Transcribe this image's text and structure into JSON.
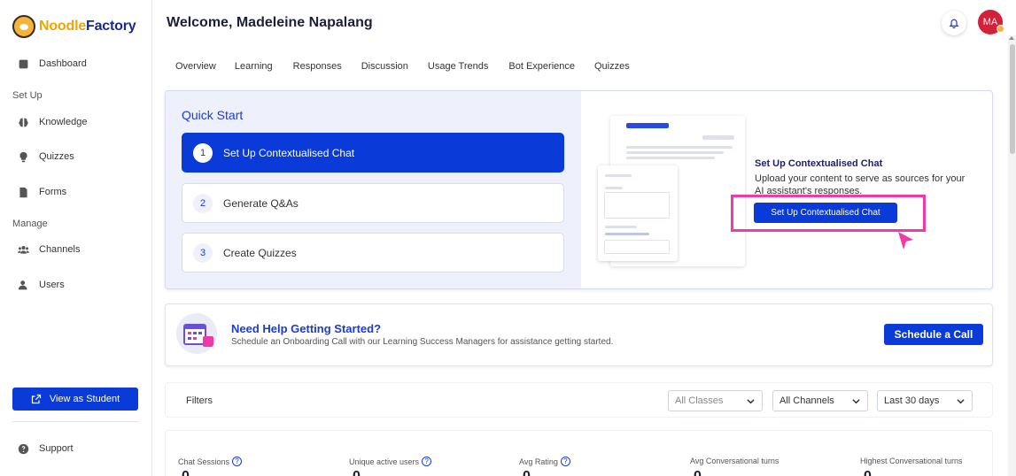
{
  "brand": {
    "name_part1": "Noodle",
    "name_part2": "Factory"
  },
  "sidebar": {
    "dashboard": "Dashboard",
    "setup_label": "Set Up",
    "knowledge": "Knowledge",
    "quizzes": "Quizzes",
    "forms": "Forms",
    "manage_label": "Manage",
    "channels": "Channels",
    "users": "Users",
    "view_student": "View as Student",
    "support": "Support"
  },
  "header": {
    "title": "Welcome, Madeleine Napalang",
    "avatar_initials": "MA"
  },
  "tabs": [
    "Overview",
    "Learning",
    "Responses",
    "Discussion",
    "Usage Trends",
    "Bot Experience",
    "Quizzes"
  ],
  "quick_start": {
    "title": "Quick Start",
    "steps": [
      {
        "num": "1",
        "label": "Set Up Contextualised Chat",
        "active": true
      },
      {
        "num": "2",
        "label": "Generate Q&As",
        "active": false
      },
      {
        "num": "3",
        "label": "Create Quizzes",
        "active": false
      }
    ],
    "cta_title": "Set Up Contextualised Chat",
    "cta_desc": "Upload your content to serve as sources for your AI assistant's responses.",
    "cta_button": "Set Up Contextualised Chat"
  },
  "help": {
    "title": "Need Help Getting Started?",
    "desc": "Schedule an Onboarding Call with our Learning Success Managers for assistance getting started.",
    "button": "Schedule a Call"
  },
  "filters": {
    "label": "Filters",
    "classes": "All Classes",
    "channels": "All Channels",
    "period": "Last 30 days"
  },
  "stats": [
    {
      "label": "Chat Sessions",
      "value": "0",
      "help": true
    },
    {
      "label": "Unique active users",
      "value": "0",
      "help": true
    },
    {
      "label": "Avg Rating",
      "value": "0",
      "help": true
    },
    {
      "label": "Avg Conversational turns",
      "value": "0",
      "help": false
    },
    {
      "label": "Highest Conversational turns",
      "value": "0",
      "help": false
    }
  ],
  "colors": {
    "primary": "#0a3ad8",
    "highlight": "#f03aa8",
    "brand_orange": "#f0a500",
    "brand_navy": "#1a2a8a",
    "avatar": "#d4213a"
  }
}
